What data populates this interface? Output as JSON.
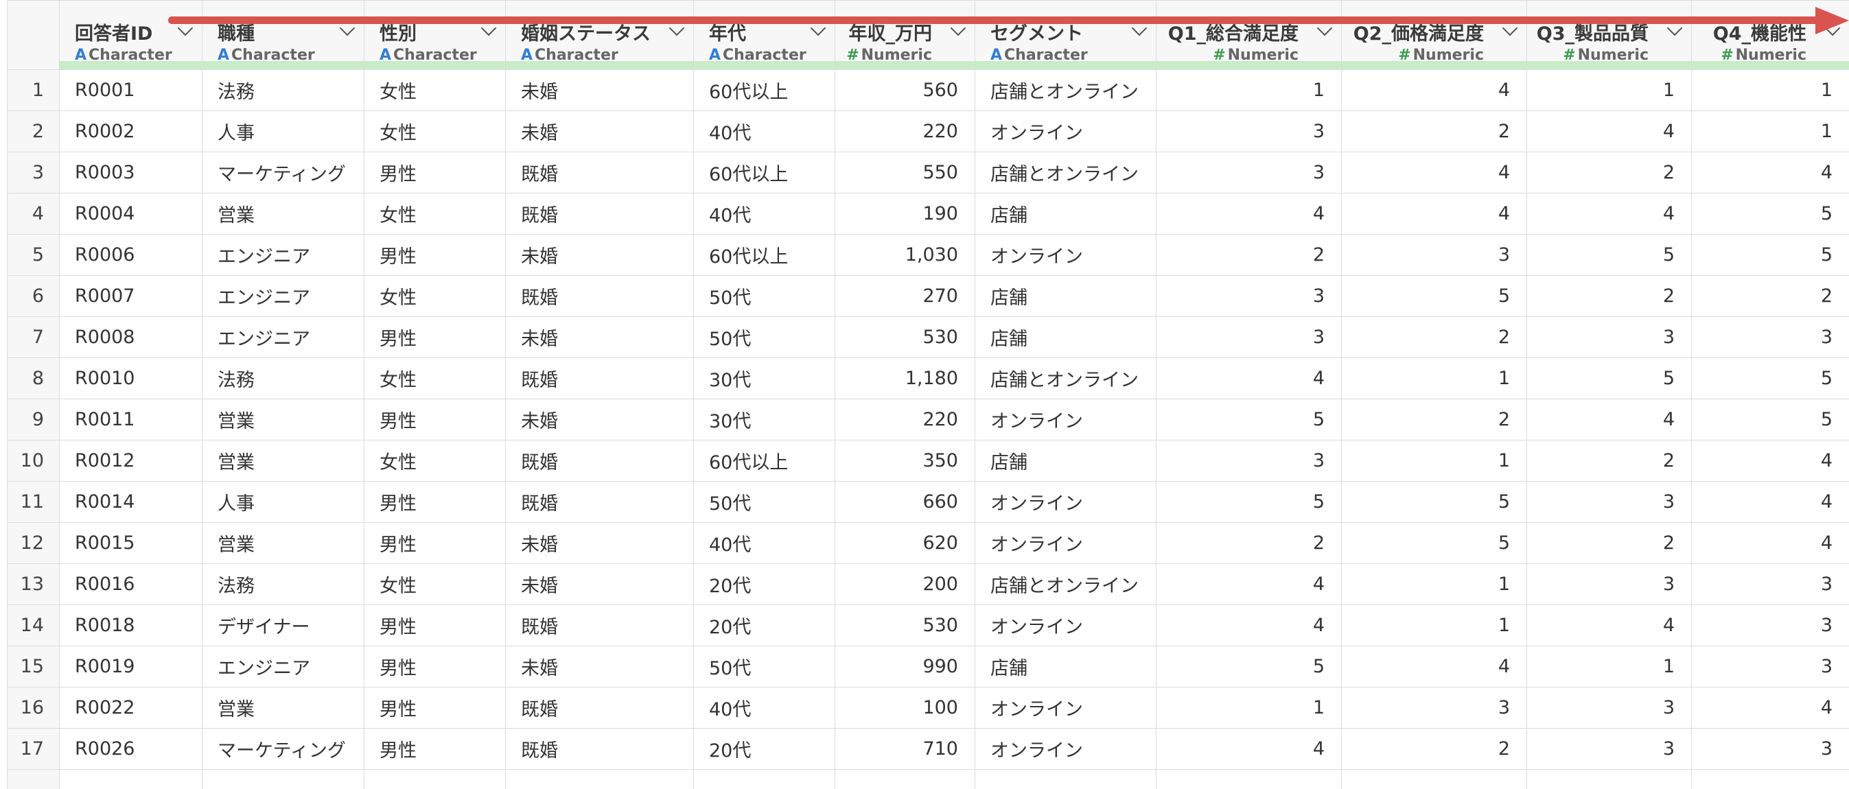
{
  "columns": [
    {
      "name": "回答者ID",
      "type": "Character",
      "icon": "character-type-icon"
    },
    {
      "name": "職種",
      "type": "Character",
      "icon": "character-type-icon"
    },
    {
      "name": "性別",
      "type": "Character",
      "icon": "character-type-icon"
    },
    {
      "name": "婚姻ステータス",
      "type": "Character",
      "icon": "character-type-icon"
    },
    {
      "name": "年代",
      "type": "Character",
      "icon": "character-type-icon"
    },
    {
      "name": "年収_万円",
      "type": "Numeric",
      "icon": "numeric-type-icon"
    },
    {
      "name": "セグメント",
      "type": "Character",
      "icon": "character-type-icon"
    },
    {
      "name": "Q1_総合満足度",
      "type": "Numeric",
      "icon": "numeric-type-icon"
    },
    {
      "name": "Q2_価格満足度",
      "type": "Numeric",
      "icon": "numeric-type-icon"
    },
    {
      "name": "Q3_製品品質",
      "type": "Numeric",
      "icon": "numeric-type-icon"
    },
    {
      "name": "Q4_機能性",
      "type": "Numeric",
      "icon": "numeric-type-icon"
    }
  ],
  "type_icon_glyphs": {
    "Character": "A",
    "Numeric": "#"
  },
  "rows": [
    {
      "n": "1",
      "c": [
        "R0001",
        "法務",
        "女性",
        "未婚",
        "60代以上",
        "560",
        "店舗とオンライン",
        "1",
        "4",
        "1",
        "1"
      ]
    },
    {
      "n": "2",
      "c": [
        "R0002",
        "人事",
        "女性",
        "未婚",
        "40代",
        "220",
        "オンライン",
        "3",
        "2",
        "4",
        "1"
      ]
    },
    {
      "n": "3",
      "c": [
        "R0003",
        "マーケティング",
        "男性",
        "既婚",
        "60代以上",
        "550",
        "店舗とオンライン",
        "3",
        "4",
        "2",
        "4"
      ]
    },
    {
      "n": "4",
      "c": [
        "R0004",
        "営業",
        "女性",
        "既婚",
        "40代",
        "190",
        "店舗",
        "4",
        "4",
        "4",
        "5"
      ]
    },
    {
      "n": "5",
      "c": [
        "R0006",
        "エンジニア",
        "男性",
        "未婚",
        "60代以上",
        "1,030",
        "オンライン",
        "2",
        "3",
        "5",
        "5"
      ]
    },
    {
      "n": "6",
      "c": [
        "R0007",
        "エンジニア",
        "女性",
        "既婚",
        "50代",
        "270",
        "店舗",
        "3",
        "5",
        "2",
        "2"
      ]
    },
    {
      "n": "7",
      "c": [
        "R0008",
        "エンジニア",
        "男性",
        "未婚",
        "50代",
        "530",
        "店舗",
        "3",
        "2",
        "3",
        "3"
      ]
    },
    {
      "n": "8",
      "c": [
        "R0010",
        "法務",
        "女性",
        "既婚",
        "30代",
        "1,180",
        "店舗とオンライン",
        "4",
        "1",
        "5",
        "5"
      ]
    },
    {
      "n": "9",
      "c": [
        "R0011",
        "営業",
        "男性",
        "未婚",
        "30代",
        "220",
        "オンライン",
        "5",
        "2",
        "4",
        "5"
      ]
    },
    {
      "n": "10",
      "c": [
        "R0012",
        "営業",
        "女性",
        "既婚",
        "60代以上",
        "350",
        "店舗",
        "3",
        "1",
        "2",
        "4"
      ]
    },
    {
      "n": "11",
      "c": [
        "R0014",
        "人事",
        "男性",
        "既婚",
        "50代",
        "660",
        "オンライン",
        "5",
        "5",
        "3",
        "4"
      ]
    },
    {
      "n": "12",
      "c": [
        "R0015",
        "営業",
        "男性",
        "未婚",
        "40代",
        "620",
        "オンライン",
        "2",
        "5",
        "2",
        "4"
      ]
    },
    {
      "n": "13",
      "c": [
        "R0016",
        "法務",
        "女性",
        "未婚",
        "20代",
        "200",
        "店舗とオンライン",
        "4",
        "1",
        "3",
        "3"
      ]
    },
    {
      "n": "14",
      "c": [
        "R0018",
        "デザイナー",
        "男性",
        "既婚",
        "20代",
        "530",
        "オンライン",
        "4",
        "1",
        "4",
        "3"
      ]
    },
    {
      "n": "15",
      "c": [
        "R0019",
        "エンジニア",
        "男性",
        "未婚",
        "50代",
        "990",
        "店舗",
        "5",
        "4",
        "1",
        "3"
      ]
    },
    {
      "n": "16",
      "c": [
        "R0022",
        "営業",
        "男性",
        "既婚",
        "40代",
        "100",
        "オンライン",
        "1",
        "3",
        "3",
        "4"
      ]
    },
    {
      "n": "17",
      "c": [
        "R0026",
        "マーケティング",
        "男性",
        "既婚",
        "20代",
        "710",
        "オンライン",
        "4",
        "2",
        "3",
        "3"
      ]
    }
  ],
  "colors": {
    "arrow": "#d9534f",
    "character_icon": "#2f7fd6",
    "numeric_icon": "#3a9d4f",
    "quality_bar": "#c7ecc7"
  }
}
